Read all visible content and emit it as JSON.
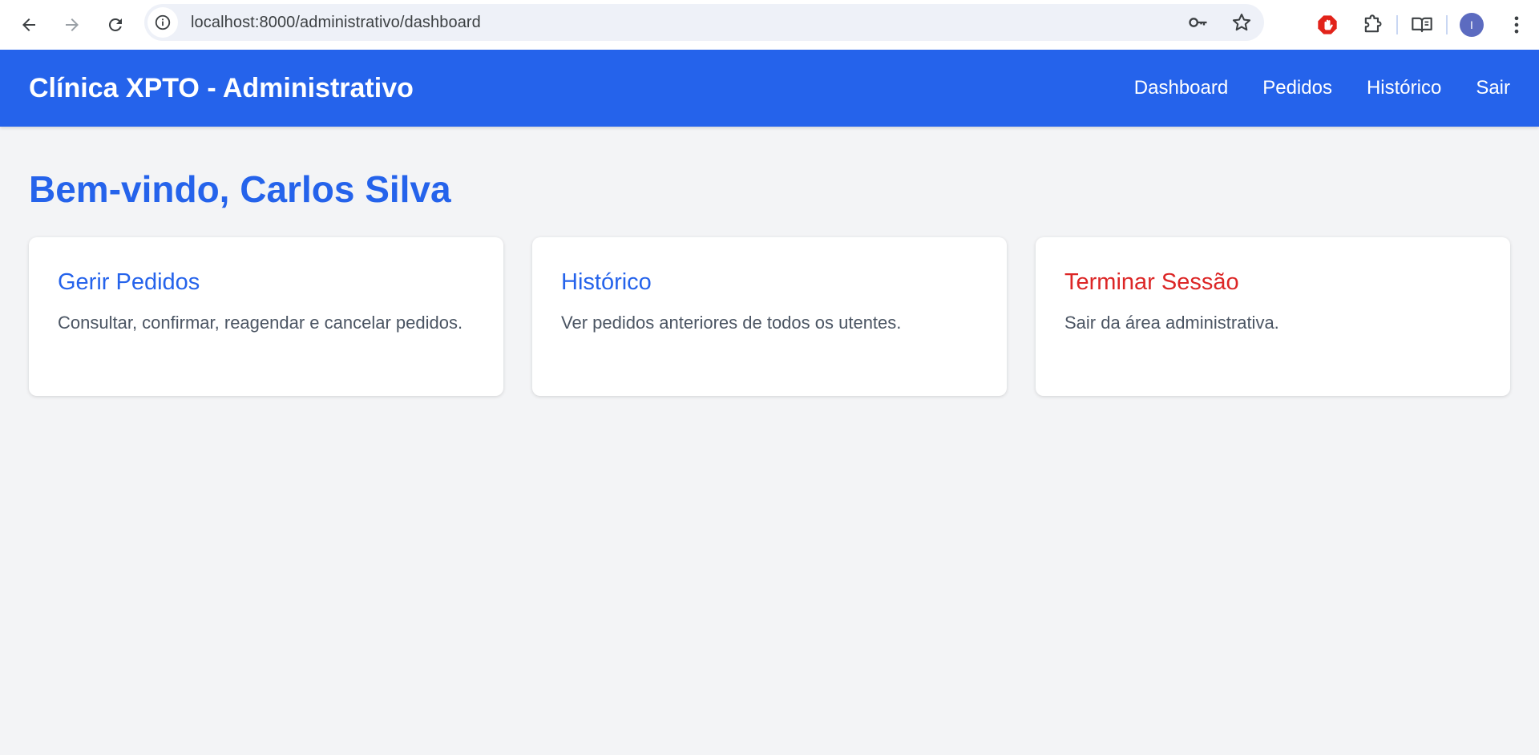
{
  "browser": {
    "url": "localhost:8000/administrativo/dashboard",
    "avatar_letter": "I"
  },
  "header": {
    "title": "Clínica XPTO - Administrativo",
    "nav": [
      "Dashboard",
      "Pedidos",
      "Histórico",
      "Sair"
    ]
  },
  "main": {
    "welcome": "Bem-vindo, Carlos Silva",
    "cards": [
      {
        "title": "Gerir Pedidos",
        "description": "Consultar, confirmar, reagendar e cancelar pedidos."
      },
      {
        "title": "Histórico",
        "description": "Ver pedidos anteriores de todos os utentes."
      },
      {
        "title": "Terminar Sessão",
        "description": "Sair da área administrativa."
      }
    ]
  },
  "colors": {
    "brand": "#2563eb",
    "danger": "#dc2626",
    "background": "#f3f4f6"
  },
  "icons": [
    "back-arrow-icon",
    "forward-arrow-icon",
    "reload-icon",
    "info-icon",
    "key-icon",
    "star-icon",
    "stop-hand-icon",
    "puzzle-icon",
    "reading-mode-icon",
    "kebab-menu-icon"
  ]
}
